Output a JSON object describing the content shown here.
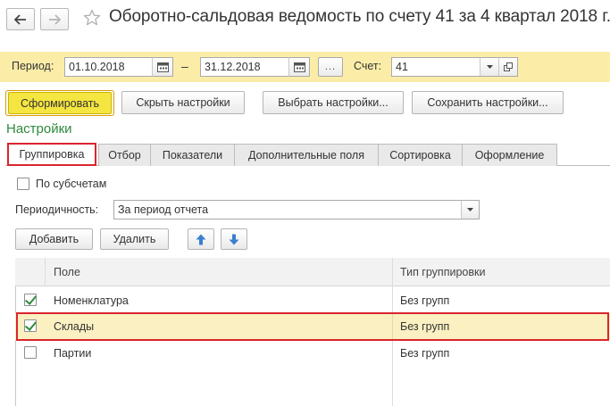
{
  "header": {
    "title": "Оборотно-сальдовая ведомость по счету 41 за 4 квартал 2018 г."
  },
  "period_bar": {
    "period_label": "Период:",
    "date_from": "01.10.2018",
    "dash": "–",
    "date_to": "31.12.2018",
    "dots_label": "...",
    "account_label": "Счет:",
    "account_value": "41"
  },
  "toolbar": {
    "generate_label": "Сформировать",
    "hide_settings_label": "Скрыть настройки",
    "choose_settings_label": "Выбрать настройки...",
    "save_settings_label": "Сохранить настройки..."
  },
  "settings": {
    "title": "Настройки",
    "tabs": [
      {
        "label": "Группировка"
      },
      {
        "label": "Отбор"
      },
      {
        "label": "Показатели"
      },
      {
        "label": "Дополнительные поля"
      },
      {
        "label": "Сортировка"
      },
      {
        "label": "Оформление"
      }
    ],
    "by_subaccounts_label": "По субсчетам",
    "periodicity_label": "Периодичность:",
    "periodicity_value": "За период отчета",
    "add_label": "Добавить",
    "delete_label": "Удалить"
  },
  "grouping_table": {
    "columns": [
      "Поле",
      "Тип группировки"
    ],
    "rows": [
      {
        "field": "Номенклатура",
        "type": "Без групп",
        "checked": true
      },
      {
        "field": "Склады",
        "type": "Без групп",
        "checked": true
      },
      {
        "field": "Партии",
        "type": "Без групп",
        "checked": false
      }
    ]
  },
  "colors": {
    "period_bar_bg": "#fbeda8",
    "primary_button": "#f5e540",
    "section_title": "#2d8a3e",
    "highlight_outline": "#d9252d",
    "selected_row_bg": "#fbf0c2",
    "arrow_blue": "#3a7fd0",
    "check_green": "#2f8b3f"
  },
  "icons": [
    "back-arrow-icon",
    "forward-arrow-icon",
    "favorite-star-icon",
    "calendar-icon",
    "dropdown-arrow-icon",
    "open-form-icon",
    "move-up-icon",
    "move-down-icon",
    "checkmark-icon"
  ]
}
